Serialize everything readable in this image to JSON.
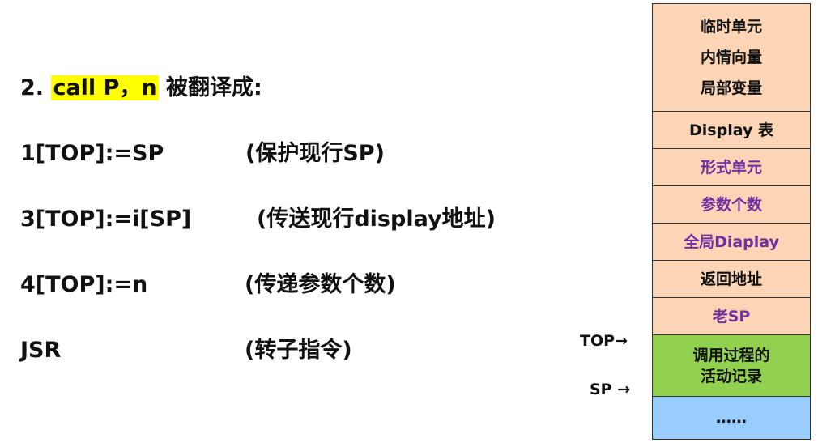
{
  "heading": {
    "number": "2.",
    "highlight": "call P，n",
    "suffix": "被翻译成:"
  },
  "instructions": [
    {
      "code": "1[TOP]:=SP",
      "comment": "(保护现行SP)"
    },
    {
      "code": "3[TOP]:=i[SP]",
      "comment": "(传送现行display地址)"
    },
    {
      "code": "4[TOP]:=n",
      "comment": "(传递参数个数)"
    },
    {
      "code": "JSR",
      "comment": "(转子指令)"
    }
  ],
  "stack": {
    "cells": [
      {
        "lines": [
          "临时单元",
          "内情向量",
          "局部变量"
        ],
        "bg": "#fbd5b5",
        "text_color": "#111111"
      },
      {
        "lines": [
          "Display 表"
        ],
        "bg": "#fbd5b5",
        "text_color": "#111111"
      },
      {
        "lines": [
          "形式单元"
        ],
        "bg": "#fbd5b5",
        "text_color": "#7030a0"
      },
      {
        "lines": [
          "参数个数"
        ],
        "bg": "#fbd5b5",
        "text_color": "#7030a0"
      },
      {
        "lines": [
          "全局Diaplay"
        ],
        "bg": "#fbd5b5",
        "text_color": "#7030a0"
      },
      {
        "lines": [
          "返回地址"
        ],
        "bg": "#fbd5b5",
        "text_color": "#111111"
      },
      {
        "lines": [
          "老SP"
        ],
        "bg": "#fbd5b5",
        "text_color": "#7030a0"
      },
      {
        "lines": [
          "调用过程的",
          "活动记录"
        ],
        "bg": "#92d050",
        "text_color": "#111111"
      },
      {
        "lines": [
          "……"
        ],
        "bg": "#99ccff",
        "text_color": "#111111"
      }
    ],
    "pointers": {
      "top": "TOP→",
      "sp": "SP →"
    }
  }
}
